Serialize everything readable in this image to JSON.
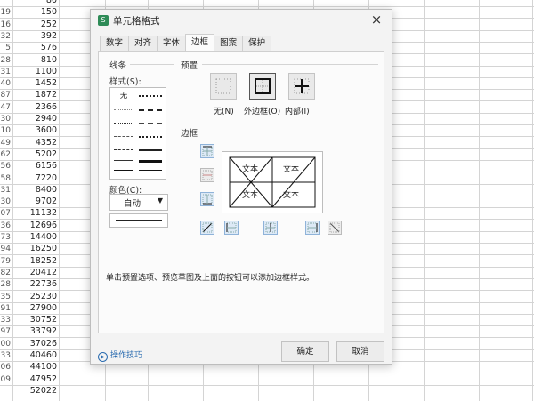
{
  "sheet": {
    "rows": [
      {
        "rn": "",
        "val": "80"
      },
      {
        "rn": "19",
        "val": "150"
      },
      {
        "rn": "16",
        "val": "252"
      },
      {
        "rn": "32",
        "val": "392"
      },
      {
        "rn": "5",
        "val": "576"
      },
      {
        "rn": "28",
        "val": "810"
      },
      {
        "rn": "31",
        "val": "1100"
      },
      {
        "rn": "40",
        "val": "1452"
      },
      {
        "rn": "87",
        "val": "1872"
      },
      {
        "rn": "47",
        "val": "2366"
      },
      {
        "rn": "30",
        "val": "2940"
      },
      {
        "rn": "10",
        "val": "3600"
      },
      {
        "rn": "49",
        "val": "4352"
      },
      {
        "rn": "62",
        "val": "5202"
      },
      {
        "rn": "56",
        "val": "6156"
      },
      {
        "rn": "58",
        "val": "7220"
      },
      {
        "rn": "31",
        "val": "8400"
      },
      {
        "rn": "30",
        "val": "9702"
      },
      {
        "rn": "07",
        "val": "11132"
      },
      {
        "rn": "36",
        "val": "12696"
      },
      {
        "rn": "73",
        "val": "14400"
      },
      {
        "rn": "94",
        "val": "16250"
      },
      {
        "rn": "79",
        "val": "18252"
      },
      {
        "rn": "82",
        "val": "20412"
      },
      {
        "rn": "28",
        "val": "22736"
      },
      {
        "rn": "35",
        "val": "25230"
      },
      {
        "rn": "91",
        "val": "27900"
      },
      {
        "rn": "33",
        "val": "30752"
      },
      {
        "rn": "97",
        "val": "33792"
      },
      {
        "rn": "00",
        "val": "37026"
      },
      {
        "rn": "33",
        "val": "40460"
      },
      {
        "rn": "06",
        "val": "44100"
      },
      {
        "rn": "09",
        "val": "47952"
      },
      {
        "rn": "",
        "val": "52022"
      }
    ]
  },
  "dialog": {
    "title": "单元格格式",
    "close_glyph": "×",
    "app_icon": "S",
    "tabs": [
      "数字",
      "对齐",
      "字体",
      "边框",
      "图案",
      "保护"
    ],
    "active_tab": "边框",
    "line_group_label": "线条",
    "style_label": "样式(S):",
    "style_none": "无",
    "color_label": "颜色(C):",
    "color_value": "自动",
    "color_arrow": "▼",
    "preset_label": "预置",
    "preset_none": "无(N)",
    "preset_outline": "外边框(O)",
    "preset_inside": "内部(I)",
    "border_label": "边框",
    "preview_text": "文本",
    "hint": "单击预置选项、预览草图及上面的按钮可以添加边框样式。",
    "tips_label": "操作技巧",
    "ok_label": "确定",
    "cancel_label": "取消"
  },
  "colors": {
    "accent": "#2b6cb0",
    "border_btn": "#dde9f6",
    "dialog_bg": "#f3f3f3"
  }
}
